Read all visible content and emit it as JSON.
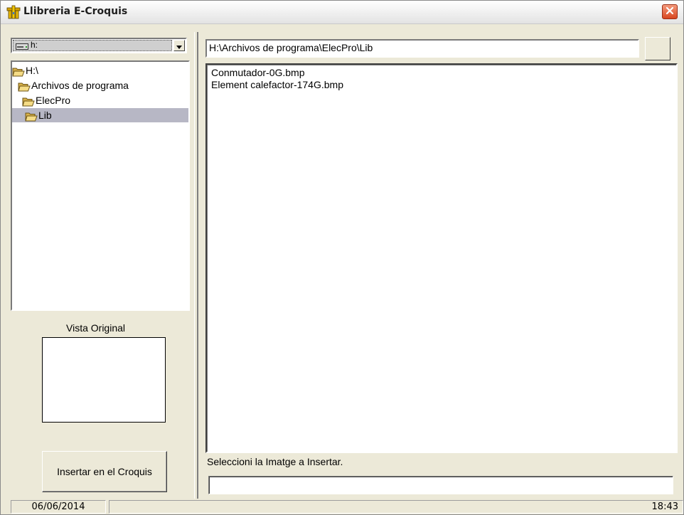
{
  "window": {
    "title": "Llibreria E-Croquis",
    "icon": "app-building-icon",
    "close_icon": "close-icon",
    "close_color": "#d8461f"
  },
  "left_panel": {
    "drive": {
      "label": "h:",
      "icon": "drive-icon"
    },
    "tree": [
      {
        "label": "H:\\",
        "icon": "open-folder-icon",
        "selected": false
      },
      {
        "label": "Archivos de programa",
        "icon": "open-folder-icon",
        "selected": false
      },
      {
        "label": "ElecPro",
        "icon": "open-folder-icon",
        "selected": false
      },
      {
        "label": "Lib",
        "icon": "open-folder-icon",
        "selected": true
      }
    ],
    "preview_label": "Vista Original",
    "insert_button": "Insertar en el Croquis"
  },
  "right_panel": {
    "path": "H:\\Archivos de programa\\ElecPro\\Lib",
    "files": [
      "Conmutador-0G.bmp",
      "Element calefactor-174G.bmp"
    ],
    "status_message": "Seleccioni la Imatge a Insertar."
  },
  "statusbar": {
    "date": "06/06/2014",
    "time": "18:43"
  }
}
